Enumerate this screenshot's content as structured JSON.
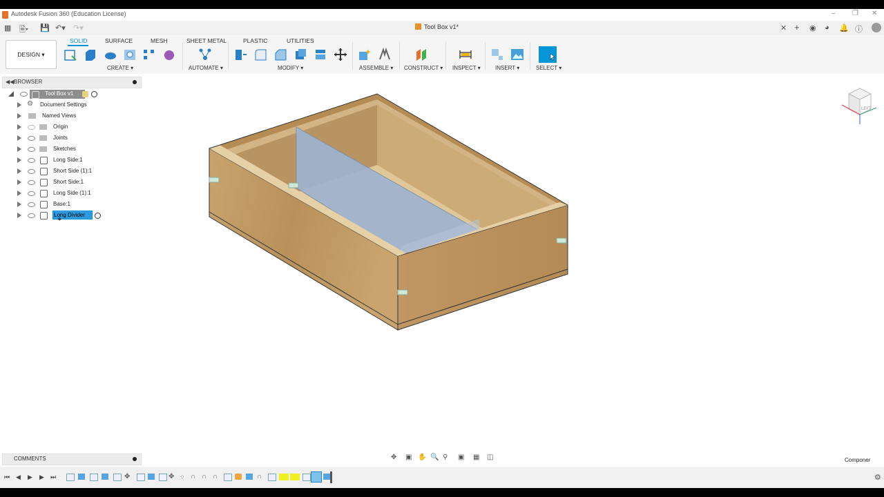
{
  "window": {
    "title": "Autodesk Fusion 360 (Education License)"
  },
  "document": {
    "tab_title": "Tool Box v1*"
  },
  "ribbon": {
    "design_label": "DESIGN ▾",
    "tabs": [
      "SOLID",
      "SURFACE",
      "MESH",
      "SHEET METAL",
      "PLASTIC",
      "UTILITIES"
    ],
    "groups": {
      "create": "CREATE ▾",
      "automate": "AUTOMATE ▾",
      "modify": "MODIFY ▾",
      "assemble": "ASSEMBLE ▾",
      "construct": "CONSTRUCT ▾",
      "inspect": "INSPECT ▾",
      "insert": "INSERT ▾",
      "select": "SELECT ▾"
    }
  },
  "browser": {
    "title": "BROWSER",
    "root": "Tool Box v1",
    "items": [
      {
        "label": "Document Settings",
        "icon": "gear-icon"
      },
      {
        "label": "Named Views",
        "icon": "folder-icon"
      },
      {
        "label": "Origin",
        "icon": "folder-icon"
      },
      {
        "label": "Joints",
        "icon": "folder-icon"
      },
      {
        "label": "Sketches",
        "icon": "folder-icon"
      },
      {
        "label": "Long Side:1",
        "icon": "component-icon"
      },
      {
        "label": "Short Side (1):1",
        "icon": "component-icon"
      },
      {
        "label": "Short Side:1",
        "icon": "component-icon"
      },
      {
        "label": "Long Side (1):1",
        "icon": "component-icon"
      },
      {
        "label": "Base:1",
        "icon": "component-icon"
      }
    ],
    "editing_value": "Long Divider"
  },
  "comments": {
    "title": "COMMENTS"
  },
  "viewcube": {
    "face": "LEFT"
  },
  "status": {
    "component_label": "Componer"
  },
  "colors": {
    "accent": "#0696d7",
    "wood": "#c8a068",
    "divider": "#9fb3cf"
  }
}
